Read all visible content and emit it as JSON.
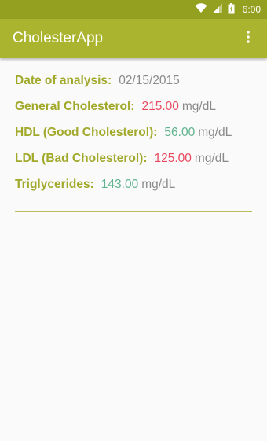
{
  "status_bar": {
    "time": "6:00",
    "icons": [
      "wifi-icon",
      "signal-icon",
      "battery-icon"
    ]
  },
  "app_bar": {
    "title": "CholesterApp",
    "overflow_icon": "more-vert-icon"
  },
  "colors": {
    "status_bar": "#94a120",
    "app_bar": "#abb42e",
    "label": "#a1a92a",
    "date_value": "#8a8a8a",
    "high_value": "#e84a5f",
    "normal_value": "#5fb38f",
    "unit": "#8a8a8a",
    "divider": "#b8bf5a"
  },
  "analysis": {
    "date": {
      "label": "Date of analysis:",
      "value": "02/15/2015"
    },
    "general": {
      "label": "General Cholesterol:",
      "value": "215.00",
      "unit": "mg/dL",
      "status": "high"
    },
    "hdl": {
      "label": "HDL (Good Cholesterol):",
      "value": "56.00",
      "unit": "mg/dL",
      "status": "normal"
    },
    "ldl": {
      "label": "LDL (Bad Cholesterol):",
      "value": "125.00",
      "unit": "mg/dL",
      "status": "high"
    },
    "triglycerides": {
      "label": "Triglycerides:",
      "value": "143.00",
      "unit": "mg/dL",
      "status": "normal"
    }
  }
}
